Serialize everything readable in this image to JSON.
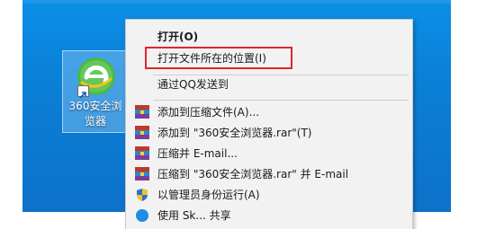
{
  "desktop": {
    "shortcut": {
      "label": "360安全浏览器",
      "icon": "360-browser-icon"
    }
  },
  "context_menu": {
    "items": [
      {
        "label": "打开(O)",
        "bold": true,
        "icon": ""
      },
      {
        "label": "打开文件所在的位置(I)",
        "bold": false,
        "icon": "",
        "highlighted": true
      },
      {
        "label": "通过QQ发送到",
        "bold": false,
        "icon": ""
      },
      {
        "label": "添加到压缩文件(A)...",
        "bold": false,
        "icon": "winrar-icon"
      },
      {
        "label": "添加到 \"360安全浏览器.rar\"(T)",
        "bold": false,
        "icon": "winrar-icon"
      },
      {
        "label": "压缩并 E-mail...",
        "bold": false,
        "icon": "winrar-icon"
      },
      {
        "label": "压缩到 \"360安全浏览器.rar\" 并 E-mail",
        "bold": false,
        "icon": "winrar-icon"
      },
      {
        "label": "以管理员身份运行(A)",
        "bold": false,
        "icon": "admin-shield-icon"
      },
      {
        "label": "使用 Sk... 共享",
        "bold": false,
        "icon": "share-icon",
        "partially_visible": true
      }
    ]
  },
  "colors": {
    "desktop_blue": "#0b80d8",
    "menu_background": "#f2f2f2",
    "highlight_border": "#e0262b"
  }
}
